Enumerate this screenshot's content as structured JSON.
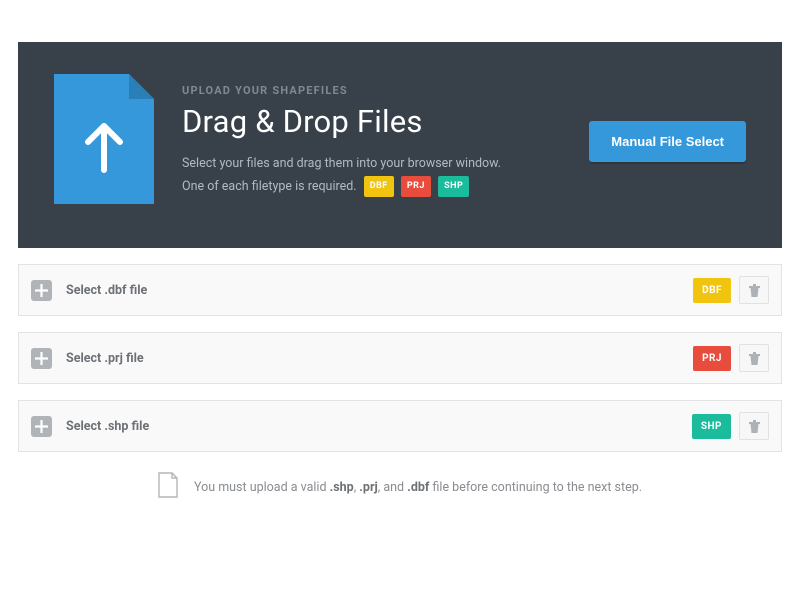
{
  "hero": {
    "eyebrow": "UPLOAD YOUR SHAPEFILES",
    "title": "Drag & Drop Files",
    "desc_line1": "Select your files and drag them into your browser window.",
    "desc_line2_prefix": "One of each filetype is required.",
    "tags": {
      "dbf": "DBF",
      "prj": "PRJ",
      "shp": "SHP"
    },
    "manual_button": "Manual File Select"
  },
  "rows": {
    "dbf": {
      "label": "Select .dbf file",
      "badge": "DBF"
    },
    "prj": {
      "label": "Select .prj file",
      "badge": "PRJ"
    },
    "shp": {
      "label": "Select .shp file",
      "badge": "SHP"
    }
  },
  "footer": {
    "pre": "You must upload a valid ",
    "shp": ".shp",
    "sep1": ", ",
    "prj": ".prj",
    "sep2": ", and ",
    "dbf": ".dbf",
    "post": " file before continuing to the next step."
  },
  "colors": {
    "dbf": "#f1c40f",
    "prj": "#e74c3c",
    "shp": "#1abc9c",
    "accent": "#3498db",
    "hero_bg": "#384049"
  }
}
